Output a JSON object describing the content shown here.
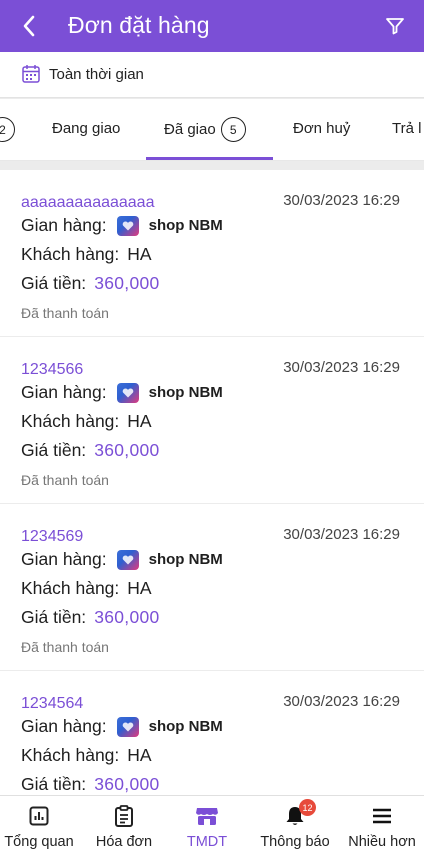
{
  "header": {
    "title": "Đơn đặt hàng"
  },
  "time_filter": {
    "label": "Toàn thời gian"
  },
  "tabs": [
    {
      "label": "",
      "count": "2"
    },
    {
      "label": "Đang giao",
      "count": ""
    },
    {
      "label": "Đã giao",
      "count": "5",
      "active": true
    },
    {
      "label": "Đơn huỷ",
      "count": ""
    },
    {
      "label": "Trả l",
      "count": ""
    }
  ],
  "orders": [
    {
      "code": "aaaaaaaaaaaaaaa",
      "datetime": "30/03/2023 16:29",
      "shop_label": "Gian hàng:",
      "shop_name": "shop NBM",
      "customer_label": "Khách hàng:",
      "customer": "HA",
      "price_label": "Giá tiền:",
      "price": "360,000",
      "payment_status": "Đã thanh toán"
    },
    {
      "code": "1234566",
      "datetime": "30/03/2023 16:29",
      "shop_label": "Gian hàng:",
      "shop_name": "shop NBM",
      "customer_label": "Khách hàng:",
      "customer": "HA",
      "price_label": "Giá tiền:",
      "price": "360,000",
      "payment_status": "Đã thanh toán"
    },
    {
      "code": "1234569",
      "datetime": "30/03/2023 16:29",
      "shop_label": "Gian hàng:",
      "shop_name": "shop NBM",
      "customer_label": "Khách hàng:",
      "customer": "HA",
      "price_label": "Giá tiền:",
      "price": "360,000",
      "payment_status": "Đã thanh toán"
    },
    {
      "code": "1234564",
      "datetime": "30/03/2023 16:29",
      "shop_label": "Gian hàng:",
      "shop_name": "shop NBM",
      "customer_label": "Khách hàng:",
      "customer": "HA",
      "price_label": "Giá tiền:",
      "price": "360,000",
      "payment_status": ""
    }
  ],
  "bottom_nav": [
    {
      "label": "Tổng quan",
      "icon": "report-icon"
    },
    {
      "label": "Hóa đơn",
      "icon": "invoice-icon"
    },
    {
      "label": "TMDT",
      "icon": "store-icon",
      "active": true
    },
    {
      "label": "Thông báo",
      "icon": "bell-icon",
      "badge": "12"
    },
    {
      "label": "Nhiều hơn",
      "icon": "menu-icon"
    }
  ],
  "colors": {
    "primary": "#7b4fd6",
    "badge": "#e74a3b"
  }
}
